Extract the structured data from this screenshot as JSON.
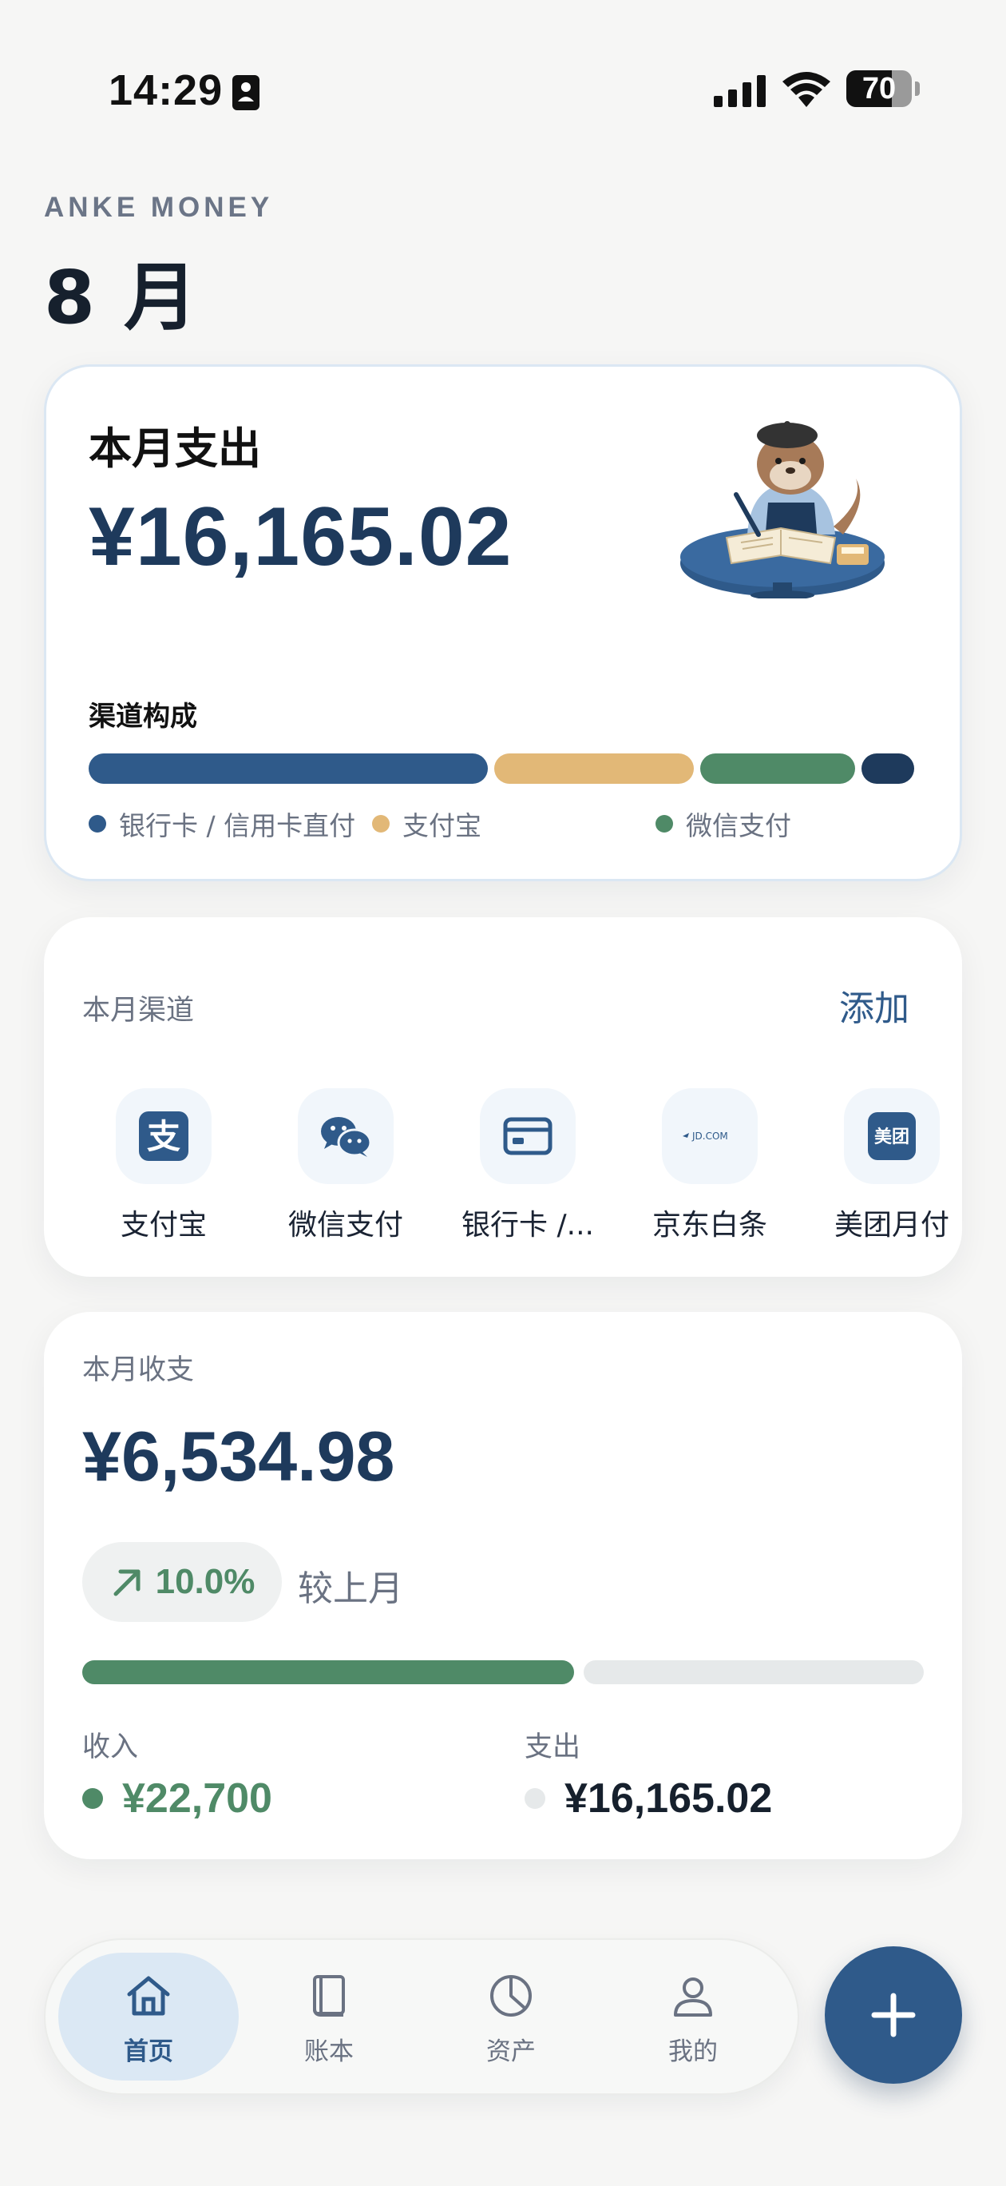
{
  "status_bar": {
    "time": "14:29",
    "battery": "70",
    "battery_level": 0.7,
    "icons": [
      "id-card-icon",
      "cellular-signal-icon",
      "wifi-icon",
      "battery-icon"
    ]
  },
  "header": {
    "app_label": "ANKE MONEY",
    "month": "8 月"
  },
  "spend_card": {
    "title": "本月支出",
    "amount": "¥16,165.02",
    "illustration": "otter-accountant-illustration",
    "composition_label": "渠道构成",
    "composition": [
      {
        "name": "银行卡 / 信用卡直付",
        "share": 0.49,
        "color": "#2f5a8a"
      },
      {
        "name": "支付宝",
        "share": 0.245,
        "color": "#e2b877"
      },
      {
        "name": "微信支付",
        "share": 0.19,
        "color": "#4f8a67"
      },
      {
        "name": "",
        "share": 0.065,
        "color": "#1e3a5c"
      }
    ],
    "legend": [
      {
        "label": "银行卡 / 信用卡直付",
        "color": "#2f5a8a"
      },
      {
        "label": "支付宝",
        "color": "#e2b877"
      },
      {
        "label": "微信支付",
        "color": "#4f8a67"
      }
    ]
  },
  "channels_card": {
    "title": "本月渠道",
    "add_label": "添加",
    "items": [
      {
        "label": "支付宝",
        "icon": "alipay-icon"
      },
      {
        "label": "微信支付",
        "icon": "wechat-pay-icon"
      },
      {
        "label": "银行卡 /...",
        "icon": "bank-card-icon"
      },
      {
        "label": "京东白条",
        "icon": "jd-baitiao-icon",
        "logo_text": "JD.COM"
      },
      {
        "label": "美团月付",
        "icon": "meituan-icon",
        "logo_text": "美团"
      }
    ]
  },
  "balance_card": {
    "title": "本月收支",
    "net_amount": "¥6,534.98",
    "change": "10.0%",
    "change_icon": "trend-up-arrow-icon",
    "compare_label": "较上月",
    "income_ratio": 0.584,
    "income_label": "收入",
    "income_value": "¥22,700",
    "expense_label": "支出",
    "expense_value": "¥16,165.02",
    "colors": {
      "income": "#4f8a67",
      "expense": "#e6e9ea"
    }
  },
  "tab_bar": {
    "tabs": [
      {
        "label": "首页",
        "icon": "home-icon",
        "active": true
      },
      {
        "label": "账本",
        "icon": "ledger-book-icon",
        "active": false
      },
      {
        "label": "资产",
        "icon": "assets-pie-icon",
        "active": false
      },
      {
        "label": "我的",
        "icon": "profile-icon",
        "active": false
      }
    ],
    "fab_icon": "plus-icon"
  },
  "colors": {
    "accent": "#2f5a8a",
    "navy": "#1e3a5c",
    "green": "#4f8a67",
    "gold": "#e2b877"
  }
}
